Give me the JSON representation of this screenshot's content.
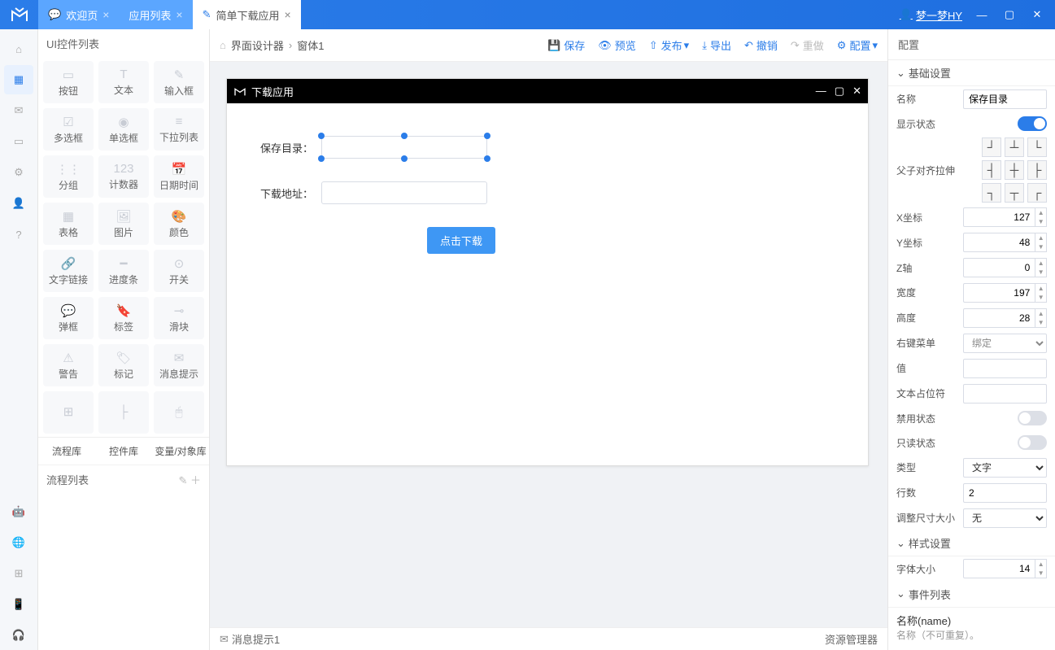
{
  "titlebar": {
    "tabs": [
      {
        "label": "欢迎页",
        "closable": true
      },
      {
        "label": "应用列表",
        "closable": true
      },
      {
        "label": "简单下载应用",
        "closable": true
      }
    ],
    "user": "梦一梦HY"
  },
  "leftpanel": {
    "title": "UI控件列表",
    "widgets": [
      {
        "icon": "▭",
        "label": "按钮"
      },
      {
        "icon": "T",
        "label": "文本"
      },
      {
        "icon": "✎",
        "label": "输入框"
      },
      {
        "icon": "☑",
        "label": "多选框"
      },
      {
        "icon": "◉",
        "label": "单选框"
      },
      {
        "icon": "≡",
        "label": "下拉列表"
      },
      {
        "icon": "⋮⋮",
        "label": "分组"
      },
      {
        "icon": "123",
        "label": "计数器"
      },
      {
        "icon": "📅",
        "label": "日期时间"
      },
      {
        "icon": "▦",
        "label": "表格"
      },
      {
        "icon": "🖼",
        "label": "图片"
      },
      {
        "icon": "🎨",
        "label": "颜色"
      },
      {
        "icon": "🔗",
        "label": "文字链接"
      },
      {
        "icon": "━",
        "label": "进度条"
      },
      {
        "icon": "⊙",
        "label": "开关"
      },
      {
        "icon": "💬",
        "label": "弹框"
      },
      {
        "icon": "🔖",
        "label": "标签"
      },
      {
        "icon": "⊸",
        "label": "滑块"
      },
      {
        "icon": "⚠",
        "label": "警告"
      },
      {
        "icon": "🏷",
        "label": "标记"
      },
      {
        "icon": "✉",
        "label": "消息提示"
      },
      {
        "icon": "⊞",
        "label": ""
      },
      {
        "icon": "├",
        "label": ""
      },
      {
        "icon": "🖱",
        "label": ""
      }
    ],
    "libtabs": [
      "流程库",
      "控件库",
      "变量/对象库"
    ],
    "flowlist": "流程列表"
  },
  "toolbar": {
    "crumb1": "界面设计器",
    "crumb2": "窗体1",
    "buttons": {
      "save": "保存",
      "preview": "预览",
      "publish": "发布",
      "export": "导出",
      "undo": "撤销",
      "redo": "重做",
      "config": "配置"
    }
  },
  "mock": {
    "title": "下载应用",
    "label_save": "保存目录：",
    "label_url": "下载地址：",
    "btn": "点击下载"
  },
  "statusbar": {
    "left": "消息提示1",
    "right": "资源管理器"
  },
  "rightpanel": {
    "head": "配置",
    "sec_basic": "基础设置",
    "sec_style": "样式设置",
    "sec_events": "事件列表",
    "labels": {
      "name": "名称",
      "visible": "显示状态",
      "align": "父子对齐拉伸",
      "x": "X坐标",
      "y": "Y坐标",
      "z": "Z轴",
      "w": "宽度",
      "h": "高度",
      "ctxmenu": "右键菜单",
      "value": "值",
      "placeholder": "文本占位符",
      "disabled": "禁用状态",
      "readonly": "只读状态",
      "type": "类型",
      "rows": "行数",
      "resize": "调整尺寸大小",
      "fontsize": "字体大小"
    },
    "vals": {
      "name": "保存目录",
      "x": "127",
      "y": "48",
      "z": "0",
      "w": "197",
      "h": "28",
      "ctxmenu": "绑定",
      "value": "",
      "placeholder": "",
      "type": "文字",
      "rows": "2",
      "resize": "无",
      "fontsize": "14"
    },
    "namearea": {
      "title": "名称(name)",
      "hint": "名称（不可重复）。"
    }
  }
}
